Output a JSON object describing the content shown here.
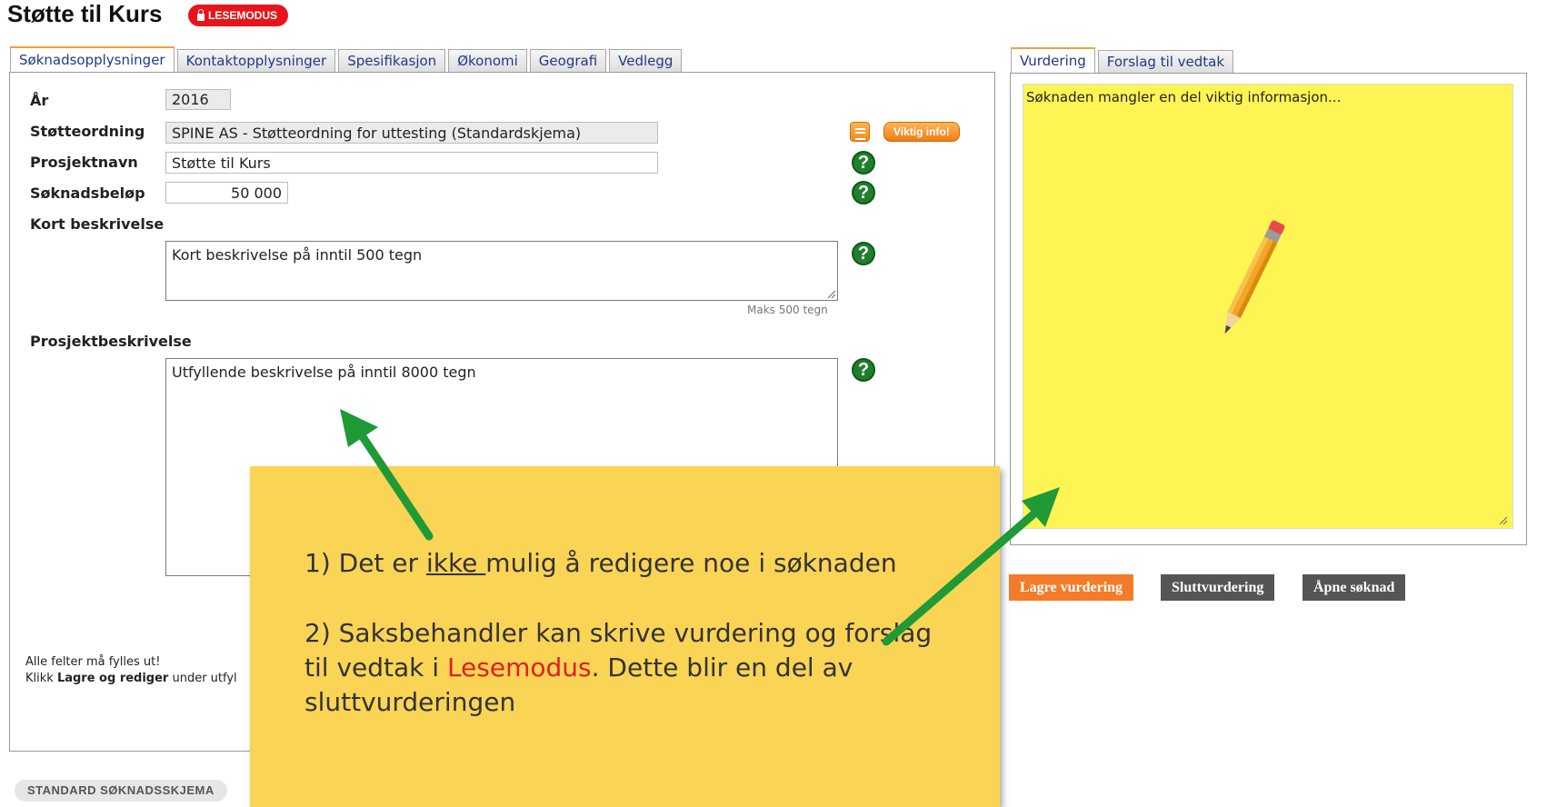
{
  "header": {
    "title": "Støtte til Kurs",
    "mode_badge": "LESEMODUS"
  },
  "left_tabs": [
    {
      "label": "Søknadsopplysninger",
      "active": true
    },
    {
      "label": "Kontaktopplysninger",
      "active": false
    },
    {
      "label": "Spesifikasjon",
      "active": false
    },
    {
      "label": "Økonomi",
      "active": false
    },
    {
      "label": "Geografi",
      "active": false
    },
    {
      "label": "Vedlegg",
      "active": false
    }
  ],
  "form": {
    "year_label": "År",
    "year_value": "2016",
    "scheme_label": "Støtteordning",
    "scheme_value": "SPINE AS - Støtteordning for uttesting (Standardskjema)",
    "project_name_label": "Prosjektnavn",
    "project_name_value": "Støtte til Kurs",
    "amount_label": "Søknadsbeløp",
    "amount_value": "50 000",
    "short_desc_label": "Kort beskrivelse",
    "short_desc_value": "Kort beskrivelse på inntil 500 tegn",
    "short_desc_hint": "Maks 500 tegn",
    "project_desc_label": "Prosjektbeskrivelse",
    "project_desc_value": "Utfyllende beskrivelse på inntil 8000 tegn",
    "important_info_button": "Viktig info!",
    "help_symbol": "?"
  },
  "footer_note": {
    "line1": "Alle felter må fylles ut!",
    "line2_prefix": "Klikk ",
    "line2_bold": "Lagre og rediger",
    "line2_suffix": " under utfyl"
  },
  "standard_form_button": "STANDARD SØKNADSSKJEMA",
  "right_tabs": [
    {
      "label": "Vurdering",
      "active": true
    },
    {
      "label": "Forslag til vedtak",
      "active": false
    }
  ],
  "assessment_text": "Søknaden mangler en del viktig informasjon...",
  "actions": [
    {
      "label": "Lagre vurdering",
      "color": "#f47b2a"
    },
    {
      "label": "Sluttvurdering",
      "color": "#555555"
    },
    {
      "label": "Åpne søknad",
      "color": "#555555"
    }
  ],
  "callout": {
    "p1_prefix": "1) Det er ",
    "p1_underlined": "ikke ",
    "p1_suffix": "mulig å redigere noe i søknaden",
    "p2_prefix": "2) Saksbehandler kan skrive vurdering og forslag til vedtak i ",
    "p2_highlight": "Lesemodus",
    "p2_suffix": ". Dette blir en del av sluttvurderingen",
    "highlight_color": "#e02020",
    "background_color": "#fad455"
  },
  "icons": {
    "arrows": "green-arrow-icon",
    "pencil": "pencil-icon",
    "notes": "note-icon",
    "help": "help-icon",
    "lock": "lock-icon"
  }
}
